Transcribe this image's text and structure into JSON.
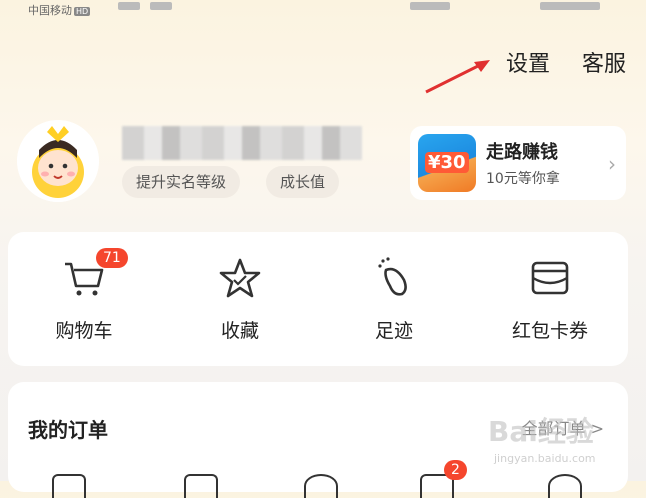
{
  "status_bar": {
    "carrier": "中国移动",
    "hd": "HD"
  },
  "top_nav": {
    "settings": "设置",
    "service": "客服"
  },
  "profile": {
    "tags": [
      "提升实名等级",
      "成长值"
    ]
  },
  "walk_promo": {
    "badge": "¥30",
    "title": "走路赚钱",
    "subtitle": "10元等你拿"
  },
  "quick_actions": [
    {
      "label": "购物车",
      "icon": "cart-icon",
      "badge": "71"
    },
    {
      "label": "收藏",
      "icon": "star-icon"
    },
    {
      "label": "足迹",
      "icon": "footprint-icon"
    },
    {
      "label": "红包卡券",
      "icon": "wallet-icon"
    }
  ],
  "orders": {
    "title": "我的订单",
    "all": "全部订单 >",
    "order_badge": "2"
  },
  "watermark": {
    "brand": "Bai经验",
    "url": "jingyan.baidu.com"
  },
  "colors": {
    "accent": "#f5462d",
    "annotation_arrow": "#e03030"
  }
}
